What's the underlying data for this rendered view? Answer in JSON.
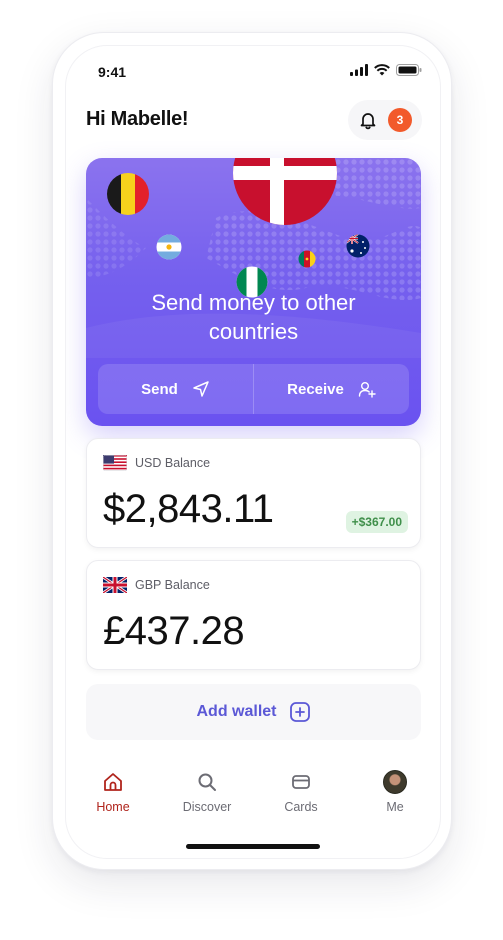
{
  "status_bar": {
    "time": "9:41"
  },
  "header": {
    "greeting": "Hi Mabelle!",
    "notification_count": "3"
  },
  "hero": {
    "title": "Send money to other countries",
    "send_label": "Send",
    "receive_label": "Receive",
    "colors": {
      "gradient_top": "#8b73ee",
      "gradient_bottom": "#6a52f0"
    }
  },
  "balances": [
    {
      "label": "USD Balance",
      "amount": "$2,843.11",
      "delta": "+$367.00"
    },
    {
      "label": "GBP Balance",
      "amount": "£437.28"
    }
  ],
  "add_wallet": {
    "label": "Add wallet"
  },
  "nav": [
    {
      "label": "Home",
      "icon": "home-icon",
      "active": true
    },
    {
      "label": "Discover",
      "icon": "search-icon",
      "active": false
    },
    {
      "label": "Cards",
      "icon": "card-icon",
      "active": false
    },
    {
      "label": "Me",
      "icon": "avatar",
      "active": false
    }
  ],
  "colors": {
    "accent": "#6a52f0",
    "badge": "#f25a2b",
    "active_nav": "#b0241c",
    "delta_bg": "#dff3e2",
    "delta_text": "#3f8f4a"
  }
}
